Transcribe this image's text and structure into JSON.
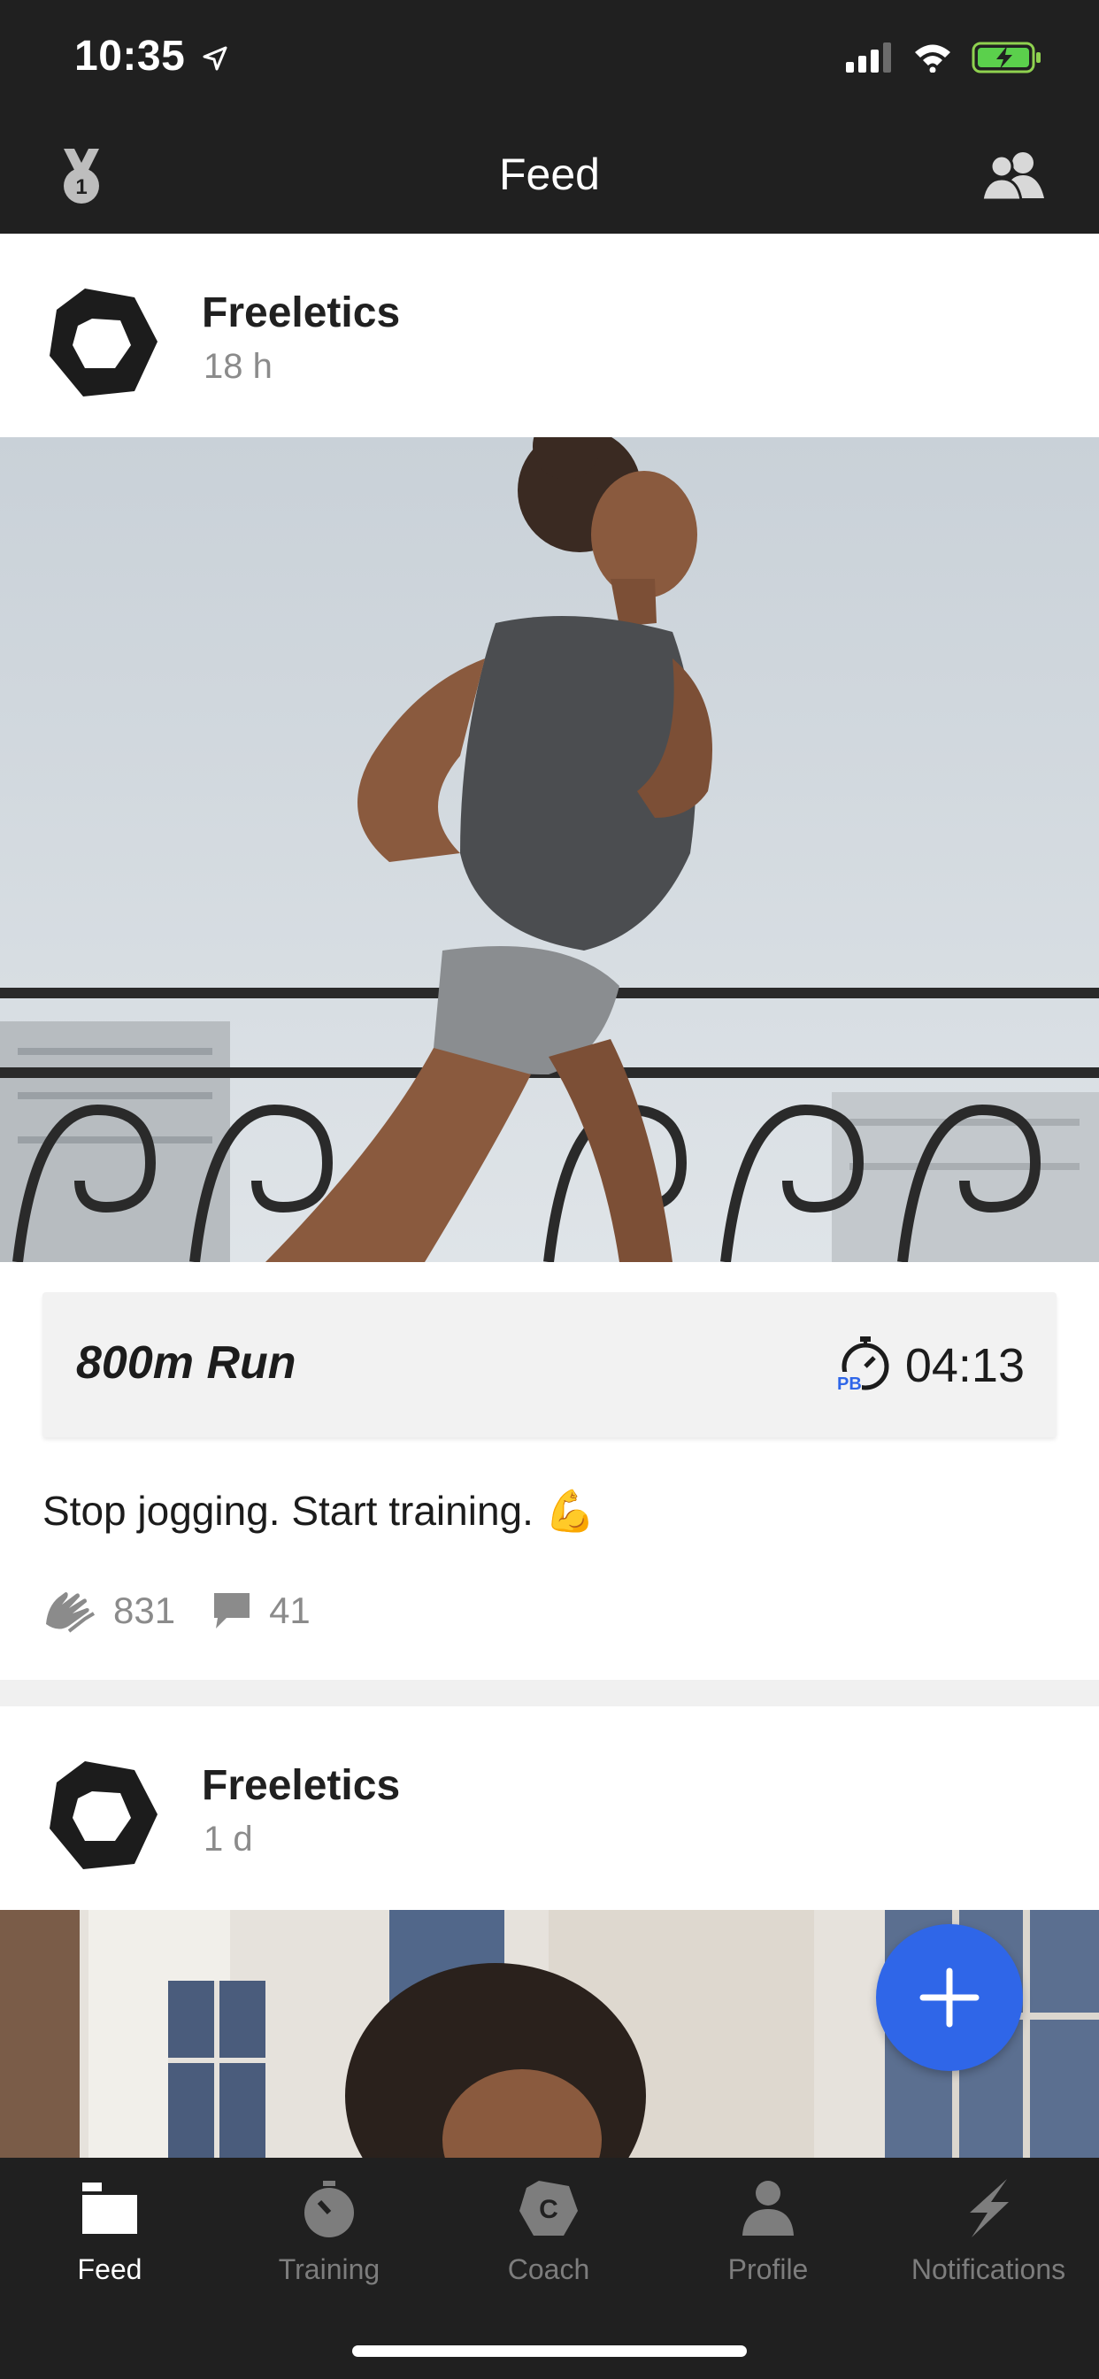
{
  "status_bar": {
    "time": "10:35"
  },
  "header": {
    "title": "Feed"
  },
  "posts": [
    {
      "author": "Freeletics",
      "time_ago": "18 h",
      "workout": {
        "name": "800m Run",
        "duration": "04:13",
        "badge": "PB"
      },
      "caption": "Stop jogging. Start training. 💪",
      "claps": "831",
      "comments": "41"
    },
    {
      "author": "Freeletics",
      "time_ago": "1 d"
    }
  ],
  "fab": {
    "icon": "plus-icon"
  },
  "tabs": [
    {
      "label": "Feed",
      "icon": "feed-icon",
      "active": true
    },
    {
      "label": "Training",
      "icon": "stopwatch-icon",
      "active": false
    },
    {
      "label": "Coach",
      "icon": "coach-icon",
      "active": false
    },
    {
      "label": "Profile",
      "icon": "profile-icon",
      "active": false
    },
    {
      "label": "Notifications",
      "icon": "lightning-icon",
      "active": false
    }
  ],
  "colors": {
    "bar_bg": "#202020",
    "accent": "#2f66e8",
    "muted": "#8b8b8b"
  }
}
